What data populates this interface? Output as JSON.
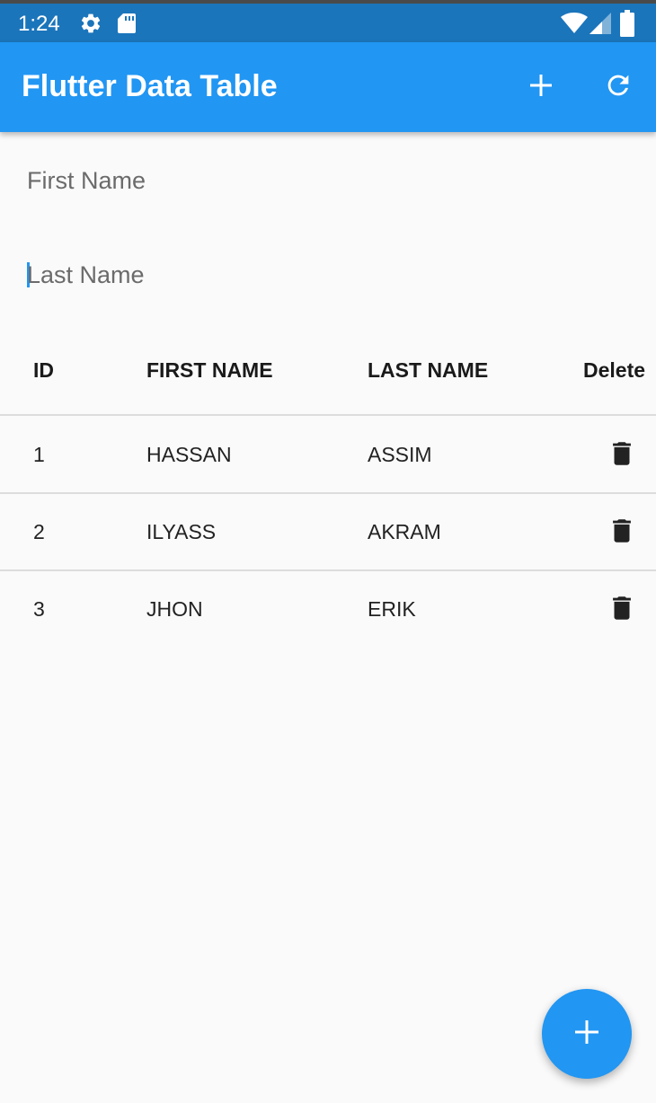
{
  "status_bar": {
    "time": "1:24",
    "left_icons": [
      "gear-icon",
      "sd-card-icon"
    ],
    "right_icons": [
      "wifi-icon",
      "cell-signal-icon",
      "battery-icon"
    ]
  },
  "app_bar": {
    "title": "Flutter Data Table",
    "actions": [
      "add-icon",
      "refresh-icon"
    ]
  },
  "form": {
    "first_name": {
      "value": "",
      "placeholder": "First Name"
    },
    "last_name": {
      "value": "",
      "placeholder": "Last Name",
      "focused": true
    }
  },
  "table": {
    "columns": [
      "ID",
      "FIRST NAME",
      "LAST NAME",
      "Delete"
    ],
    "rows": [
      {
        "id": "1",
        "first_name": "HASSAN",
        "last_name": "ASSIM"
      },
      {
        "id": "2",
        "first_name": "ILYASS",
        "last_name": "AKRAM"
      },
      {
        "id": "3",
        "first_name": "JHON",
        "last_name": "ERIK"
      }
    ]
  },
  "fab": {
    "icon": "add-icon"
  },
  "colors": {
    "primary": "#2196f3",
    "status_bar": "#1b75bb",
    "background": "#fafafa",
    "divider": "#dcdcdc",
    "text_dark": "#1a1a1a",
    "hint_text": "#6b6b6b"
  }
}
